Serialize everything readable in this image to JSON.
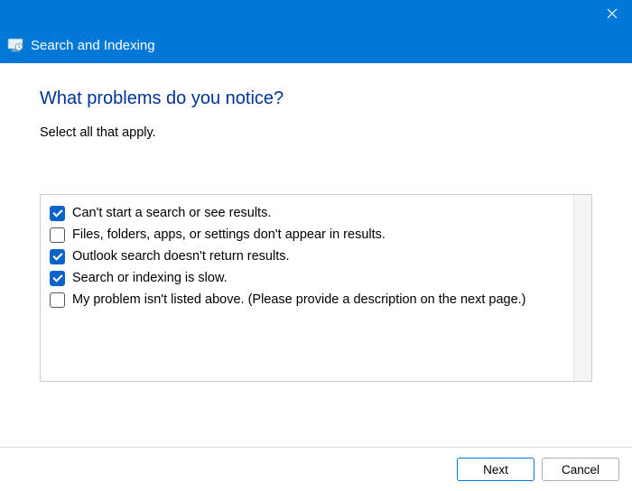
{
  "window": {
    "title": "Search and Indexing"
  },
  "page": {
    "heading": "What problems do you notice?",
    "subtext": "Select all that apply."
  },
  "options": [
    {
      "label": "Can't start a search or see results.",
      "checked": true
    },
    {
      "label": "Files, folders, apps, or settings don't appear in results.",
      "checked": false
    },
    {
      "label": "Outlook search doesn't return results.",
      "checked": true
    },
    {
      "label": "Search or indexing is slow.",
      "checked": true
    },
    {
      "label": "My problem isn't listed above. (Please provide a description on the next page.)",
      "checked": false
    }
  ],
  "footer": {
    "next": "Next",
    "cancel": "Cancel"
  }
}
